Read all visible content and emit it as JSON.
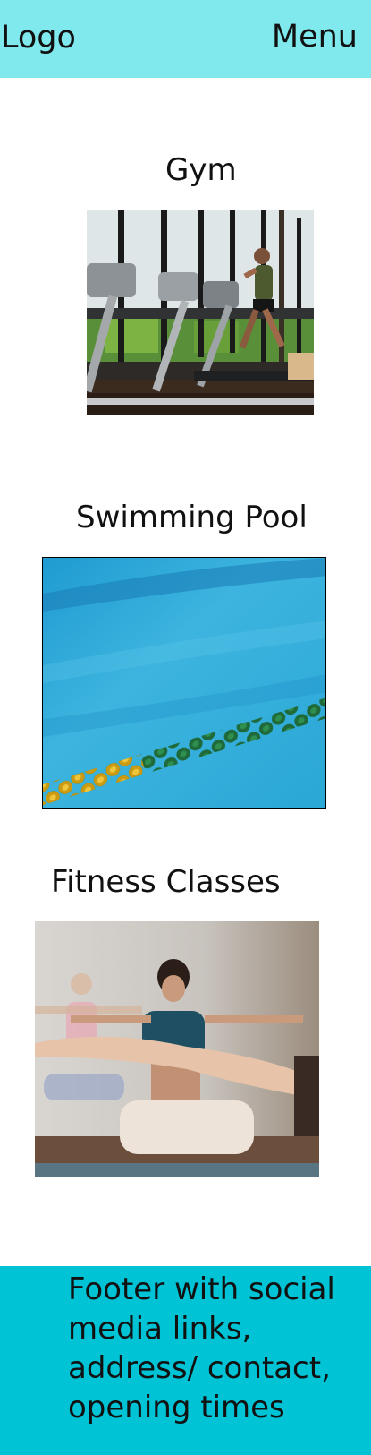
{
  "header": {
    "logo_label": "Logo",
    "menu_label": "Menu",
    "background_color": "#7fe9ee"
  },
  "sections": [
    {
      "title": "Gym",
      "image": "treadmill-photo"
    },
    {
      "title": "Swimming Pool",
      "image": "pool-lane-photo"
    },
    {
      "title": "Fitness Classes",
      "image": "yoga-class-photo"
    }
  ],
  "footer": {
    "text": "Footer with social media links, address/ contact, opening times",
    "background_color": "#00c4d6"
  }
}
